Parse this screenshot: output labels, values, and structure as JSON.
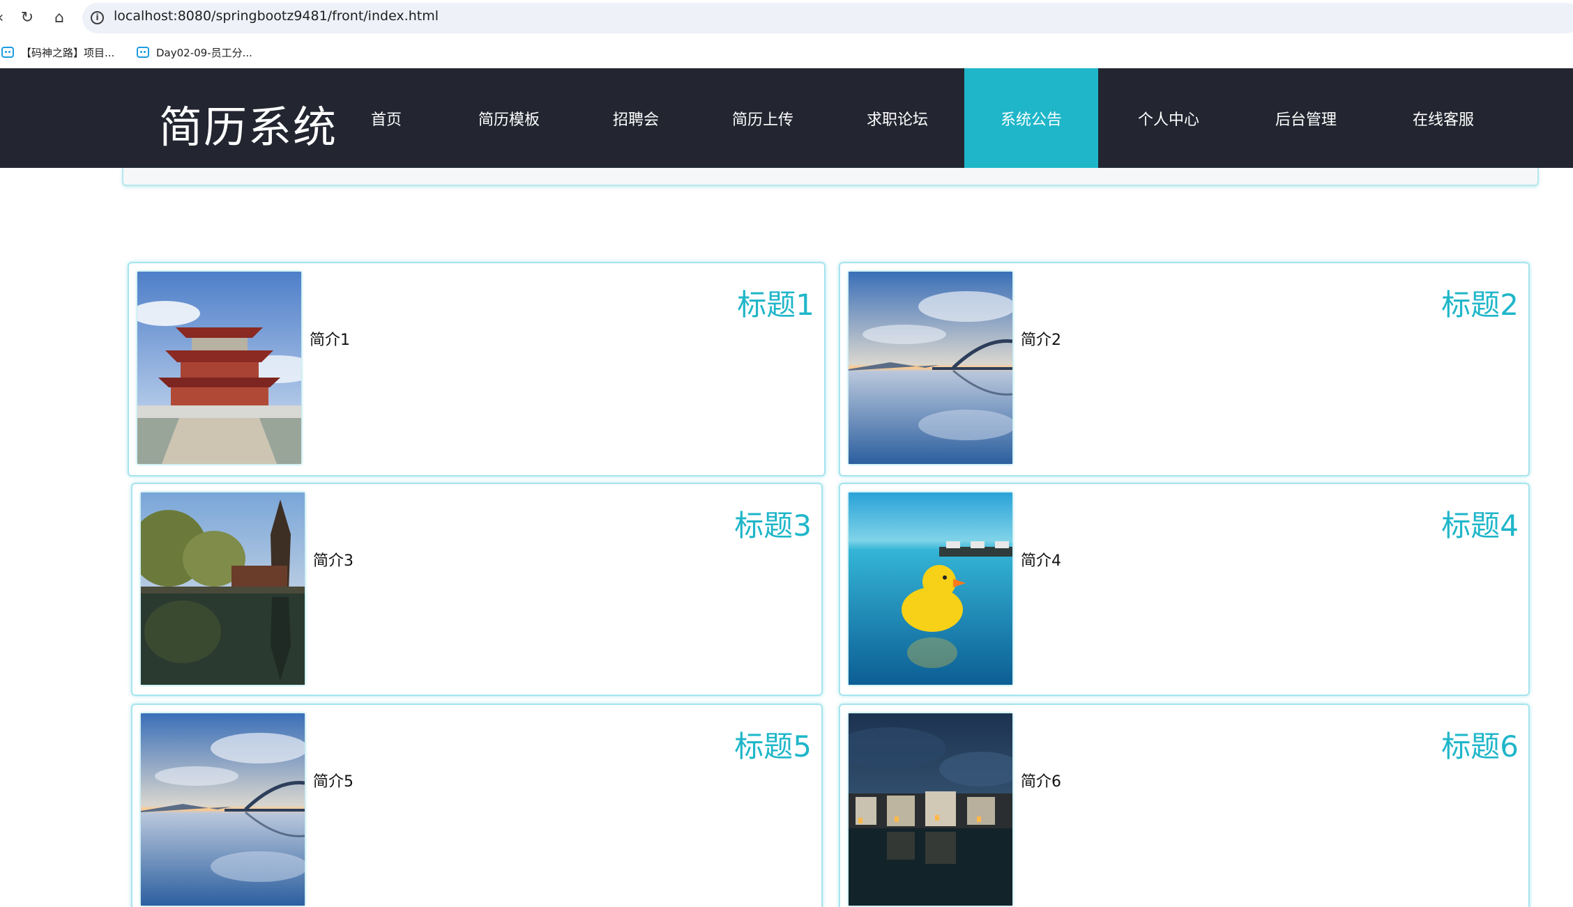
{
  "browser": {
    "url": "localhost:8080/springbootz9481/front/index.html",
    "bookmarks": [
      "【码神之路】项目...",
      "Day02-09-员工分..."
    ]
  },
  "header": {
    "brand": "简历系统",
    "nav": [
      {
        "label": "首页",
        "active": false
      },
      {
        "label": "简历模板",
        "active": false
      },
      {
        "label": "招聘会",
        "active": false
      },
      {
        "label": "简历上传",
        "active": false
      },
      {
        "label": "求职论坛",
        "active": false
      },
      {
        "label": "系统公告",
        "active": true
      },
      {
        "label": "个人中心",
        "active": false
      },
      {
        "label": "后台管理",
        "active": false
      },
      {
        "label": "在线客服",
        "active": false
      }
    ],
    "accent_color": "#1fb6c9",
    "bg_color": "#232630"
  },
  "notices": [
    {
      "title": "标题1",
      "summary": "简介1",
      "image": "pagoda-temple-photo"
    },
    {
      "title": "标题2",
      "summary": "简介2",
      "image": "lake-bridge-sunrise-photo"
    },
    {
      "title": "标题3",
      "summary": "简介3",
      "image": "pagoda-lake-reflection-photo"
    },
    {
      "title": "标题4",
      "summary": "简介4",
      "image": "rubber-duck-pool-photo"
    },
    {
      "title": "标题5",
      "summary": "简介5",
      "image": "lake-bridge-sunrise-photo"
    },
    {
      "title": "标题6",
      "summary": "简介6",
      "image": "village-night-reflection-photo"
    }
  ]
}
